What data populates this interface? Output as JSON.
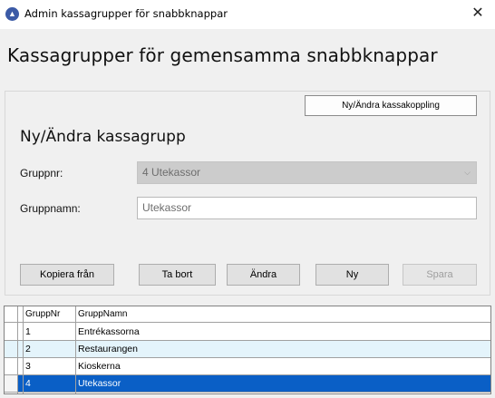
{
  "window": {
    "title": "Admin kassagrupper för snabbknappar",
    "close_glyph": "✕",
    "app_icon": "app-logo-icon"
  },
  "page": {
    "heading": "Kassagrupper för gemensamma snabbknappar"
  },
  "form": {
    "switch_button_label": "Ny/Ändra kassakoppling",
    "subheading": "Ny/Ändra kassagrupp",
    "group_number_label": "Gruppnr:",
    "group_number_value": "4  Utekassor",
    "group_name_label": "Gruppnamn:",
    "group_name_value": "Utekassor"
  },
  "actions": {
    "copy_label": "Kopiera från",
    "delete_label": "Ta bort",
    "edit_label": "Ändra",
    "new_label": "Ny",
    "save_label": "Spara"
  },
  "grid": {
    "headers": [
      "GruppNr",
      "GruppNamn"
    ],
    "rows": [
      {
        "nr": "1",
        "name": "Entrékassorna",
        "state": "normal"
      },
      {
        "nr": "2",
        "name": "Restaurangen",
        "state": "alternate"
      },
      {
        "nr": "3",
        "name": "Kioskerna",
        "state": "normal"
      },
      {
        "nr": "4",
        "name": "Utekassor",
        "state": "selected"
      }
    ]
  },
  "colors": {
    "selected_row": "#0a5fc6",
    "alternate_row": "#e4f4fb",
    "window_background": "#f0f0f0"
  }
}
